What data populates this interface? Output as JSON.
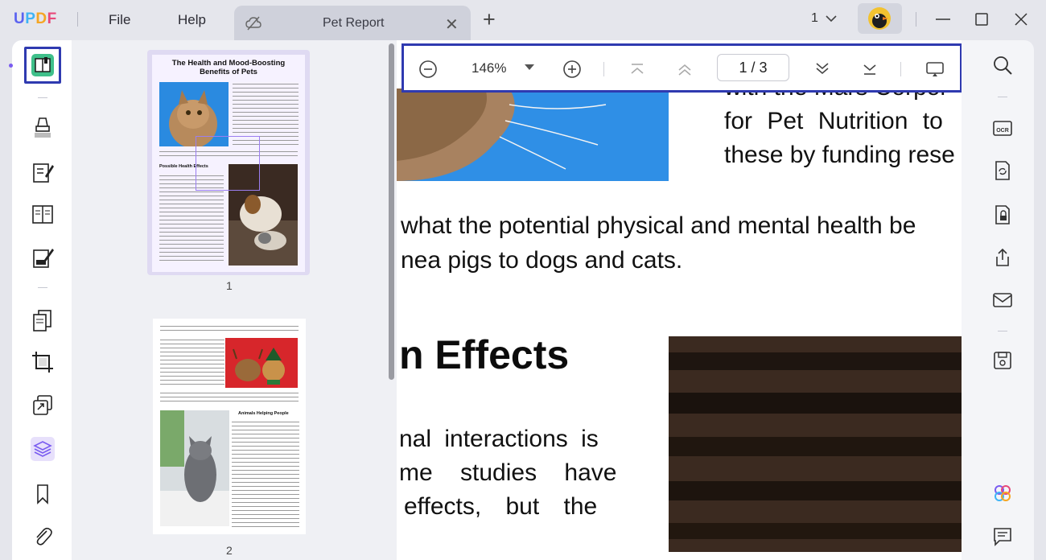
{
  "app": {
    "logo": [
      "U",
      "P",
      "D",
      "F"
    ],
    "menu": {
      "file": "File",
      "help": "Help"
    },
    "tab": {
      "title": "Pet Report"
    },
    "page_indicator": "1"
  },
  "toolbar": {
    "zoom": "146%",
    "page_current": "1",
    "page_separator": "/",
    "page_total": "3"
  },
  "thumbnails": [
    {
      "number": "1",
      "title_line1": "The Health and Mood-Boosting",
      "title_line2": "Benefits of Pets",
      "section": "Possible Health Effects"
    },
    {
      "number": "2",
      "section": "Animals Helping People"
    }
  ],
  "document": {
    "line_a": "with the Mars Corpor",
    "line_b": "for Pet Nutrition to",
    "line_c": "these by funding rese",
    "line_d": "what the potential physical and mental health be",
    "line_e": "nea pigs to dogs and cats.",
    "heading": "n Effects",
    "line_f": "nal interactions is",
    "line_g": "me studies have",
    "line_h": "effects, but the"
  },
  "colors": {
    "accent": "#2f3ab0",
    "purple": "#7a5cf0",
    "active_tool_bg": "#3fc08a"
  }
}
